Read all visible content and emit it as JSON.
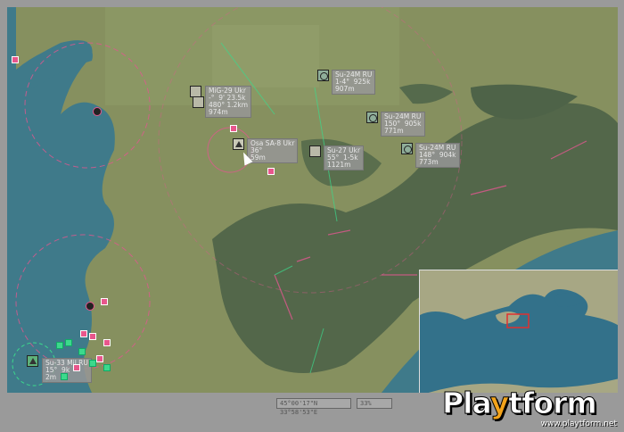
{
  "units": [
    {
      "id": "u1",
      "side": "hostile",
      "lines": [
        "MiG-29 Ukr",
        "-°  9' 23.5k",
        "480° 1.2km",
        "974m"
      ]
    },
    {
      "id": "u2",
      "side": "friendly",
      "lines": [
        "Su-24M RU",
        "1-4°  925k",
        "907m"
      ]
    },
    {
      "id": "u3",
      "side": "friendly",
      "lines": [
        "Su-24M RU",
        "150°  905k",
        "771m"
      ]
    },
    {
      "id": "u4",
      "side": "hostile",
      "lines": [
        "Su-27 Ukr",
        "55°  1-5k",
        "1121m"
      ]
    },
    {
      "id": "u5",
      "side": "friendly",
      "lines": [
        "Su-24M RU",
        "148°  904k",
        "773m"
      ]
    },
    {
      "id": "u6",
      "side": "hostile",
      "lines": [
        "Osa SA-8 Ukr",
        "36°",
        "59m"
      ]
    },
    {
      "id": "u7",
      "side": "friendly",
      "lines": [
        "Su-33 Mil RU",
        "15°  9k",
        "2m"
      ]
    }
  ],
  "status": {
    "coords": "45°00'17\"N 33°58'53\"E",
    "zoom": "33%"
  },
  "logo": {
    "brand_a": "Pla",
    "brand_y": "y",
    "brand_b": "tform",
    "url": "www.playtform.net"
  },
  "colors": {
    "water": "#3f7a8a",
    "land": "#7e8a62",
    "forest": "#4e6348",
    "pink": "#e8568c",
    "green": "#3cd98c"
  }
}
